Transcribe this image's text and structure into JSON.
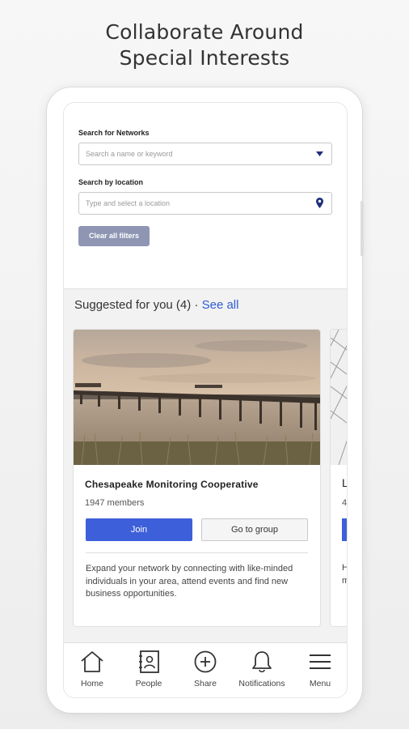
{
  "headline": {
    "line1": "Collaborate Around",
    "line2": "Special Interests"
  },
  "filters": {
    "network_label": "Search for Networks",
    "network_placeholder": "Search a name or keyword",
    "location_label": "Search by location",
    "location_placeholder": "Type and select a location",
    "clear_label": "Clear all filters"
  },
  "suggested": {
    "heading": "Suggested for you (4) ·",
    "see_all": "See all"
  },
  "card": {
    "title": "Chesapeake Monitoring Cooperative",
    "members": "1947 members",
    "join_label": "Join",
    "goto_label": "Go to group",
    "description": "Expand your network by connecting with like-minded individuals in your area, attend events and find new business opportunities."
  },
  "peek_card": {
    "title_initial": "L",
    "members_initial": "4",
    "desc_line1": "H",
    "desc_line2": "m"
  },
  "tabs": [
    {
      "label": "Home",
      "icon": "home-icon"
    },
    {
      "label": "People",
      "icon": "contacts-book-icon"
    },
    {
      "label": "Share",
      "icon": "plus-circle-icon"
    },
    {
      "label": "Notifications",
      "icon": "bell-icon"
    },
    {
      "label": "Menu",
      "icon": "hamburger-menu-icon"
    }
  ],
  "colors": {
    "accent": "#3d5fd9",
    "link": "#2e5bd6",
    "clear_button": "#8e96b4",
    "dropdown_arrow": "#1f2f7a"
  }
}
